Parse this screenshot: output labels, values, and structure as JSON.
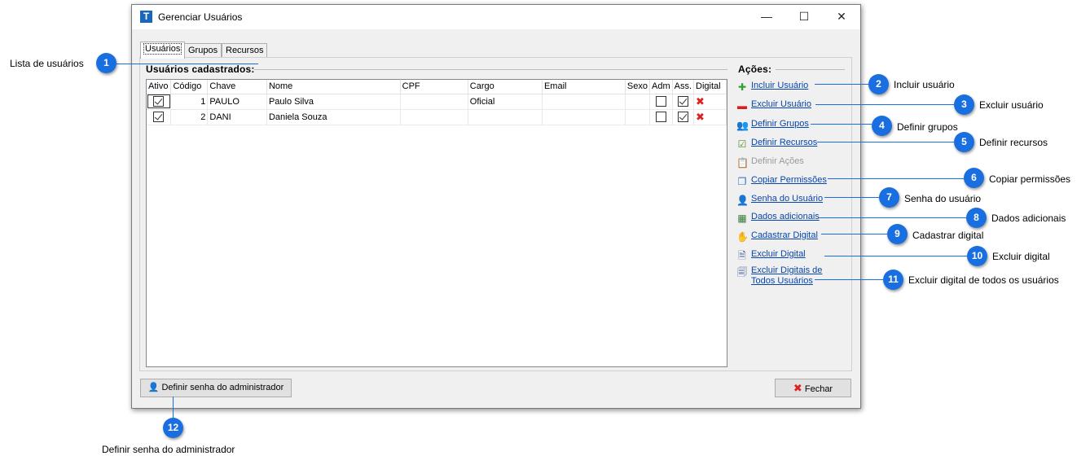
{
  "window": {
    "title": "Gerenciar Usuários",
    "min_glyph": "—",
    "max_glyph": "☐",
    "close_glyph": "✕"
  },
  "tabs": [
    {
      "label": "Usuários",
      "active": true
    },
    {
      "label": "Grupos",
      "active": false
    },
    {
      "label": "Recursos",
      "active": false
    }
  ],
  "users_group": {
    "title": "Usuários cadastrados:",
    "columns": [
      "Ativo",
      "Código",
      "Chave",
      "Nome",
      "CPF",
      "Cargo",
      "Email",
      "Sexo",
      "Adm",
      "Ass.",
      "Digital"
    ],
    "rows": [
      {
        "ativo": true,
        "codigo": "1",
        "chave": "PAULO",
        "nome": "Paulo Silva",
        "cpf": "",
        "cargo": "Oficial",
        "email": "",
        "sexo": "",
        "adm": false,
        "ass": true,
        "digital": "red-x-icon"
      },
      {
        "ativo": true,
        "codigo": "2",
        "chave": "DANI",
        "nome": "Daniela Souza",
        "cpf": "",
        "cargo": "",
        "email": "",
        "sexo": "",
        "adm": false,
        "ass": true,
        "digital": "red-x-icon"
      }
    ]
  },
  "actions_group": {
    "title": "Ações:",
    "items": [
      {
        "label": "Incluir Usuário",
        "icon": "plus-icon",
        "glyph": "✚",
        "color": "#2fa12f",
        "enabled": true
      },
      {
        "label": "Excluir Usuário",
        "icon": "minus-icon",
        "glyph": "▬",
        "color": "#d42020",
        "enabled": true
      },
      {
        "label": "Definir Grupos",
        "icon": "group-icon",
        "glyph": "👥",
        "color": "#c07020",
        "enabled": true
      },
      {
        "label": "Definir Recursos",
        "icon": "checklist-icon",
        "glyph": "☑",
        "color": "#5a8a2a",
        "enabled": true
      },
      {
        "label": "Definir Ações",
        "icon": "clipboard-check-icon",
        "glyph": "📋",
        "color": "#888888",
        "enabled": false
      },
      {
        "label": "Copiar Permissões",
        "icon": "copy-icon",
        "glyph": "❐",
        "color": "#2a6ac8",
        "enabled": true
      },
      {
        "label": "Senha do Usuário",
        "icon": "user-key-icon",
        "glyph": "👤",
        "color": "#b06020",
        "enabled": true
      },
      {
        "label": "Dados adicionais",
        "icon": "data-table-icon",
        "glyph": "▦",
        "color": "#3a7a3a",
        "enabled": true
      },
      {
        "label": "Cadastrar Digital",
        "icon": "hand-icon",
        "glyph": "✋",
        "color": "#d08030",
        "enabled": true
      },
      {
        "label": "Excluir Digital",
        "icon": "delete-digital-icon",
        "glyph": "🗎",
        "color": "#4060a0",
        "enabled": true
      },
      {
        "label": "Excluir Digitais de\nTodos Usuários",
        "icon": "delete-all-digital-icon",
        "glyph": "🗐",
        "color": "#4060a0",
        "enabled": true
      }
    ]
  },
  "footer": {
    "admin_password_button": "Definir senha do administrador",
    "close_button": "Fechar"
  },
  "callouts": [
    {
      "num": "1",
      "label": "Lista de usuários"
    },
    {
      "num": "2",
      "label": "Incluir usuário"
    },
    {
      "num": "3",
      "label": "Excluir usuário"
    },
    {
      "num": "4",
      "label": "Definir grupos"
    },
    {
      "num": "5",
      "label": "Definir recursos"
    },
    {
      "num": "6",
      "label": "Copiar permissões"
    },
    {
      "num": "7",
      "label": "Senha do usuário"
    },
    {
      "num": "8",
      "label": "Dados adicionais"
    },
    {
      "num": "9",
      "label": "Cadastrar digital"
    },
    {
      "num": "10",
      "label": "Excluir digital"
    },
    {
      "num": "11",
      "label": "Excluir digital de todos os usuários"
    },
    {
      "num": "12",
      "label": "Definir senha do administrador"
    }
  ],
  "colors": {
    "accent": "#1a6fe0",
    "link": "#0645ad",
    "title_icon": "#1a66b8"
  }
}
